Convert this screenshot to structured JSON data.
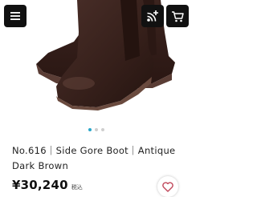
{
  "header": {
    "menu_icon": "hamburger-menu-icon",
    "share_icon": "rss-plus-icon",
    "cart_icon": "shopping-cart-icon"
  },
  "gallery": {
    "image": "dark-brown-side-gore-boots-photo",
    "slides": 3,
    "active_slide": 1
  },
  "product": {
    "title": "No.616｜Side Gore Boot｜Antique Dark Brown",
    "price": "¥30,240",
    "tax_label": "税込",
    "favorite_icon": "heart-outline-icon"
  },
  "colors": {
    "accent": "#2aa7c9",
    "favorite": "#c0475a",
    "boot": "#3b2520"
  }
}
